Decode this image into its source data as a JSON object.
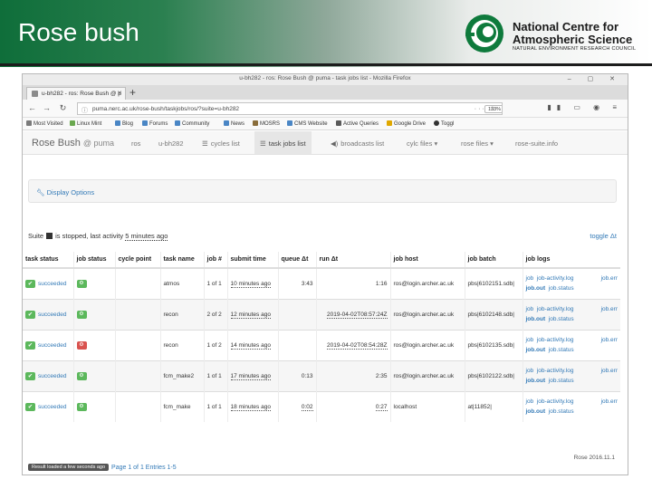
{
  "slide": {
    "title": "Rose bush",
    "logo": {
      "line1": "National Centre for",
      "line2": "Atmospheric Science",
      "line3": "NATURAL ENVIRONMENT RESEARCH COUNCIL"
    }
  },
  "browser": {
    "window_title": "u-bh282 - ros: Rose Bush @ puma - task jobs list - Mozilla Firefox",
    "tab_label": "u-bh282 - ros: Rose Bush @ p",
    "url": "puma.nerc.ac.uk/rose-bush/taskjobs/ros/?suite=u-bh282",
    "zoom": "133%",
    "bookmarks": [
      {
        "label": "Most Visited",
        "color": "#7a7a7a"
      },
      {
        "label": "Linux Mint",
        "color": "#6aa84f"
      },
      {
        "label": "Blog",
        "color": "#4a86c5"
      },
      {
        "label": "Forums",
        "color": "#4a86c5"
      },
      {
        "label": "Community",
        "color": "#4a86c5"
      },
      {
        "label": "News",
        "color": "#4a86c5"
      },
      {
        "label": "MOSRS",
        "color": "#8a6d3b"
      },
      {
        "label": "CMS Website",
        "color": "#4a86c5"
      },
      {
        "label": "Active Queries",
        "color": "#5a5a5a"
      },
      {
        "label": "Google Drive",
        "color": "#e0a800"
      },
      {
        "label": "Toggl",
        "color": "#333333"
      }
    ]
  },
  "app": {
    "brand": "Rose Bush",
    "brand_host": "@ puma",
    "nav": [
      {
        "label": "ros",
        "icon": ""
      },
      {
        "label": "u-bh282",
        "icon": ""
      },
      {
        "label": "cycles list",
        "icon": "list-icon"
      },
      {
        "label": "task jobs list",
        "icon": "list-icon",
        "active": true
      },
      {
        "label": "broadcasts list",
        "icon": "broadcast-icon"
      },
      {
        "label": "cylc files",
        "icon": "",
        "caret": true
      },
      {
        "label": "rose files",
        "icon": "",
        "caret": true
      },
      {
        "label": "rose-suite.info",
        "icon": ""
      }
    ],
    "display_options": "Display Options",
    "suite_status": {
      "prefix": "Suite",
      "state": "is stopped, last activity",
      "last_activity": "5 minutes ago"
    },
    "toggle": "toggle Δt"
  },
  "table": {
    "headers": [
      "task status",
      "job status",
      "cycle point",
      "task name",
      "job #",
      "submit time",
      "queue Δt",
      "run Δt",
      "job host",
      "job batch",
      "job logs"
    ],
    "rows": [
      {
        "task_status": "succeeded",
        "job_status": "ok",
        "cycle_point": "",
        "task_name": "atmos",
        "job_num": "1 of 1",
        "submit_time": "10 minutes ago",
        "queue_dt": "3:43",
        "run_dt": "1:16",
        "job_host": "ros@login.archer.ac.uk",
        "job_batch": "pbs|6102151.sdb|",
        "logs": [
          "job",
          "job-activity.log",
          "job.err",
          "job.out",
          "job.status"
        ]
      },
      {
        "task_status": "succeeded",
        "job_status": "ok",
        "cycle_point": "",
        "task_name": "recon",
        "job_num": "2 of 2",
        "submit_time": "12 minutes ago",
        "queue_dt": "",
        "run_dt": "2019-04-02T08:57:24Z",
        "job_host": "ros@login.archer.ac.uk",
        "job_batch": "pbs|6102148.sdb|",
        "logs": [
          "job",
          "job-activity.log",
          "job.err",
          "job.out",
          "job.status"
        ]
      },
      {
        "task_status": "succeeded",
        "job_status": "fail",
        "cycle_point": "",
        "task_name": "recon",
        "job_num": "1 of 2",
        "submit_time": "14 minutes ago",
        "queue_dt": "",
        "run_dt": "2019-04-02T08:54:28Z",
        "job_host": "ros@login.archer.ac.uk",
        "job_batch": "pbs|6102135.sdb|",
        "logs": [
          "job",
          "job-activity.log",
          "job.err",
          "job.out",
          "job.status"
        ]
      },
      {
        "task_status": "succeeded",
        "job_status": "ok",
        "cycle_point": "",
        "task_name": "fcm_make2",
        "job_num": "1 of 1",
        "submit_time": "17 minutes ago",
        "queue_dt": "0:13",
        "run_dt": "2:35",
        "job_host": "ros@login.archer.ac.uk",
        "job_batch": "pbs|6102122.sdb|",
        "logs": [
          "job",
          "job-activity.log",
          "job.err",
          "job.out",
          "job.status"
        ]
      },
      {
        "task_status": "succeeded",
        "job_status": "ok",
        "cycle_point": "",
        "task_name": "fcm_make",
        "job_num": "1 of 1",
        "submit_time": "18 minutes ago",
        "queue_dt": "0:02",
        "run_dt": "0:27",
        "job_host": "localhost",
        "job_batch": "at|11852|",
        "logs": [
          "job",
          "job-activity.log",
          "job.err",
          "job.out",
          "job.status"
        ]
      }
    ]
  },
  "footer": {
    "loaded": "Result loaded a few seconds ago",
    "pages": "Page 1 of 1 Entries 1-5",
    "version": "Rose 2016.11.1"
  },
  "colors": {
    "header_green": "#0f6e3a",
    "success": "#5cb85c",
    "danger": "#d9534f",
    "link": "#337ab7"
  }
}
